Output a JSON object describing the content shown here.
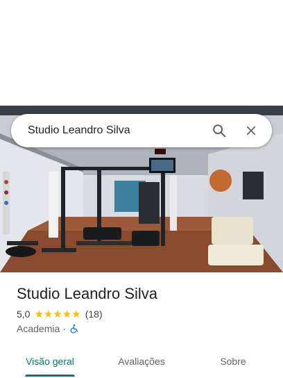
{
  "search": {
    "query": "Studio Leandro Silva"
  },
  "icons": {
    "search": "search-icon",
    "close": "close-icon",
    "accessibility": "wheelchair-icon",
    "star": "star-icon"
  },
  "place": {
    "name": "Studio Leandro Silva",
    "rating": "5,0",
    "stars": "★★★★★",
    "reviews_count": "(18)",
    "category": "Academia",
    "separator": "·"
  },
  "tabs": [
    {
      "label": "Visão geral",
      "active": true
    },
    {
      "label": "Avaliações",
      "active": false
    },
    {
      "label": "Sobre",
      "active": false
    }
  ],
  "colors": {
    "accent": "#01796f",
    "star": "#fbbc04",
    "wheelchair": "#1a73e8"
  }
}
